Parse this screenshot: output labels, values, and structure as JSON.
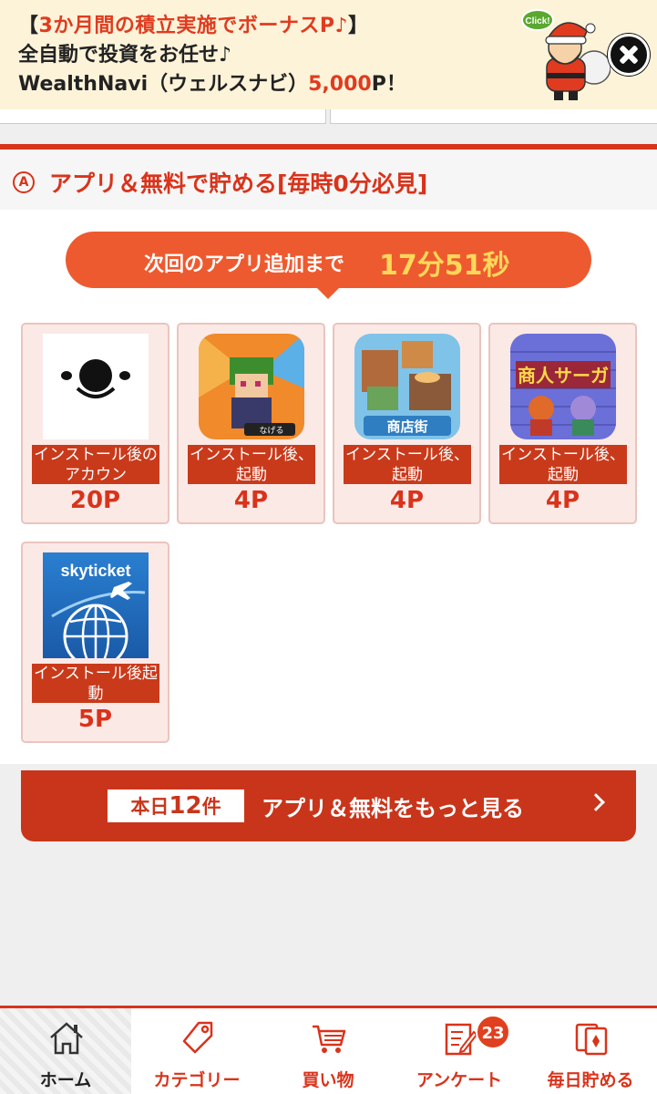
{
  "banner": {
    "line1_open": "【",
    "line1_text": "3か月間の積立実施でボーナスP♪",
    "line1_close": "】",
    "line2": "全自動で投資をお任せ♪",
    "line3_prefix": "WealthNavi（ウェルスナビ）",
    "line3_points": "5,000",
    "line3_suffix": "P！",
    "santa_label": "Click!"
  },
  "section": {
    "icon_letter": "A",
    "title": "アプリ＆無料で貯める[毎時0分必見]",
    "timer_label": "次回のアプリ追加まで",
    "timer_value": "17分51秒"
  },
  "apps": [
    {
      "icon": "face-app-icon",
      "desc": "インストール後のアカウン",
      "points": "20P"
    },
    {
      "icon": "ninja-game-icon",
      "desc": "インストール後、起動",
      "points": "4P",
      "icon_badge": "なげる"
    },
    {
      "icon": "shopping-street-icon",
      "desc": "インストール後、起動",
      "points": "4P",
      "icon_label": "商店街"
    },
    {
      "icon": "merchant-saga-icon",
      "desc": "インストール後、起動",
      "points": "4P",
      "icon_label": "商人サーガ"
    },
    {
      "icon": "skyticket-icon",
      "desc": "インストール後起動",
      "points": "5P",
      "icon_label": "skyticket"
    }
  ],
  "more": {
    "badge_prefix": "本日",
    "badge_count": "12",
    "badge_suffix": "件",
    "label": "アプリ＆無料をもっと見る"
  },
  "nav": {
    "items": [
      {
        "label": "ホーム",
        "icon": "home-icon"
      },
      {
        "label": "カテゴリー",
        "icon": "tag-icon"
      },
      {
        "label": "買い物",
        "icon": "cart-icon"
      },
      {
        "label": "アンケート",
        "icon": "survey-icon"
      },
      {
        "label": "毎日貯める",
        "icon": "cards-icon"
      }
    ],
    "survey_badge": "23"
  },
  "colors": {
    "accent": "#d9331b",
    "timer": "#ee5a2f",
    "timer_value": "#ffd85a",
    "banner_bg": "#fcf3d9"
  }
}
